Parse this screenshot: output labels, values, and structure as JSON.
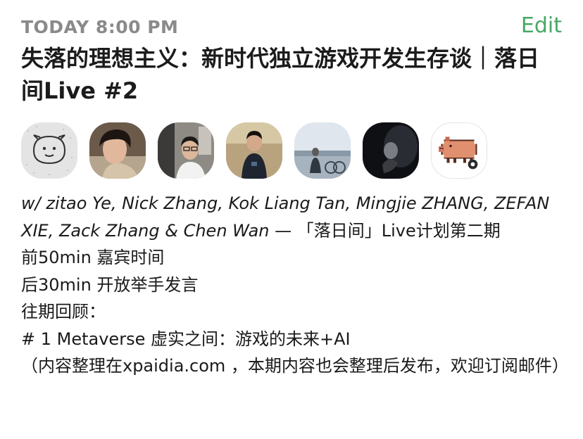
{
  "header": {
    "time": "TODAY 8:00 PM",
    "edit_label": "Edit"
  },
  "event": {
    "title": "失落的理想主义：新时代独立游戏开发生存谈｜落日间Live #2"
  },
  "avatars": [
    {
      "name": "drawn-face-avatar",
      "icon": "doodle-face"
    },
    {
      "name": "person-avatar-1",
      "icon": "photo"
    },
    {
      "name": "person-avatar-2",
      "icon": "photo"
    },
    {
      "name": "person-avatar-3",
      "icon": "photo"
    },
    {
      "name": "person-avatar-4",
      "icon": "photo"
    },
    {
      "name": "person-avatar-5",
      "icon": "photo"
    },
    {
      "name": "pixel-pig-avatar",
      "icon": "pixel-pig"
    }
  ],
  "description": {
    "guests_line": "w/ zitao Ye, Nick Zhang, Kok Liang Tan, Mingjie ZHANG, ZEFAN XIE, Zack Zhang & Chen Wan",
    "program_line": " — 「落日间」Live计划第二期",
    "line_1": "前50min 嘉宾时间",
    "line_2": "后30min 开放举手发言",
    "line_3": "往期回顾：",
    "line_4": "# 1 Metaverse 虚实之间：游戏的未来+AI",
    "line_5": "（内容整理在xpaidia.com ，本期内容也会整理后发布，欢迎订阅邮件）"
  },
  "colors": {
    "accent": "#47a865",
    "muted": "#8a8a8a",
    "text": "#1a1a1a"
  }
}
